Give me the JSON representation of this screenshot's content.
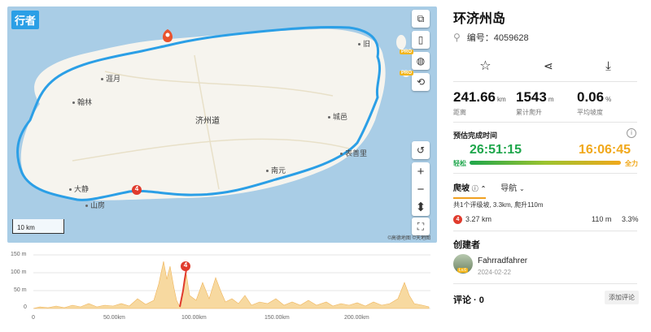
{
  "map": {
    "app_logo": "行者",
    "places": [
      {
        "name": "涯月",
        "dot": true
      },
      {
        "name": "翰林",
        "dot": true
      },
      {
        "name": "济州道",
        "dot": false
      },
      {
        "name": "城邑",
        "dot": true
      },
      {
        "name": "表善里",
        "dot": true
      },
      {
        "name": "南元",
        "dot": true
      },
      {
        "name": "大静",
        "dot": true
      },
      {
        "name": "旧",
        "dot": true
      },
      {
        "name": "山房",
        "dot": true
      }
    ],
    "scale_label": "10 km",
    "attribution": "©高德地图 ©天地图",
    "pro_badge": "PRO",
    "route_color": "#2b9fe6",
    "climb_marker": "4",
    "zoom_in": "+",
    "zoom_out": "−"
  },
  "profile": {
    "y_ticks": [
      "150 m",
      "100 m",
      "50 m",
      "0"
    ],
    "x_ticks": [
      "0",
      "50.00km",
      "100.00km",
      "150.00km",
      "200.00km"
    ],
    "marker": "4"
  },
  "route": {
    "title": "环济州岛",
    "id_label": "编号：4059628"
  },
  "stats": [
    {
      "value": "241.66",
      "unit": "km",
      "label": "距离"
    },
    {
      "value": "1543",
      "unit": "m",
      "label": "累计爬升"
    },
    {
      "value": "0.06",
      "unit": "%",
      "label": "平均坡度"
    }
  ],
  "estimate": {
    "label": "预估完成时间",
    "easy_time": "26:51:15",
    "full_time": "16:06:45",
    "easy_label": "轻松",
    "full_label": "全力",
    "info": "i"
  },
  "tabs": {
    "climb": "爬坡",
    "nav": "导航"
  },
  "climb": {
    "summary": "共1个评级坡, 3.3km, 爬升110m",
    "badge": "4",
    "distance": "3.27 km",
    "gain": "110 m",
    "grade": "3.3%"
  },
  "creator": {
    "heading": "创建者",
    "name": "Fahrradfahrer",
    "date": "2024-02-22",
    "level": "Lv.6"
  },
  "comments": {
    "heading": "评论 · 0",
    "add": "添加评论"
  },
  "colors": {
    "easy": "#1ea64b",
    "full": "#f1a81b",
    "accent": "#f0a020",
    "climb_badge": "#e03b2d"
  }
}
